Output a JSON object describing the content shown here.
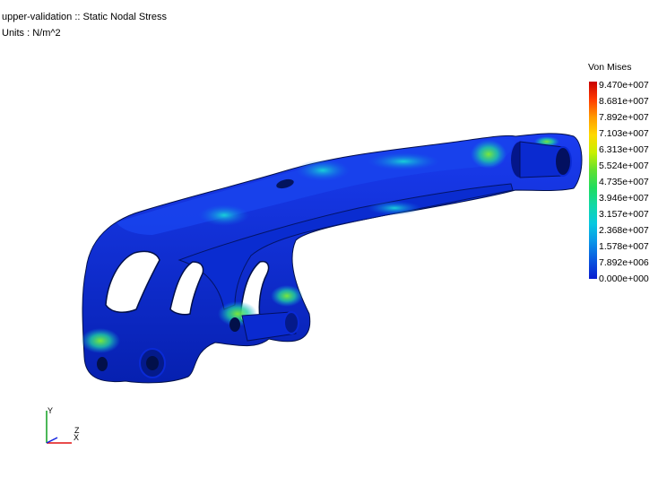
{
  "header": {
    "title": "upper-validation :: Static Nodal Stress",
    "units": "Units : N/m^2"
  },
  "legend": {
    "title": "Von Mises",
    "labels": [
      "9.470e+007",
      "8.681e+007",
      "7.892e+007",
      "7.103e+007",
      "6.313e+007",
      "5.524e+007",
      "4.735e+007",
      "3.946e+007",
      "3.157e+007",
      "2.368e+007",
      "1.578e+007",
      "7.892e+006",
      "0.000e+000"
    ]
  },
  "triad": {
    "x": "X",
    "y": "Y",
    "z": "Z"
  },
  "colors": {
    "part_blue": "#0a2ad6",
    "part_dark": "#041a8a",
    "hot_green": "#5ae030",
    "hot_cyan": "#10c8e0"
  }
}
